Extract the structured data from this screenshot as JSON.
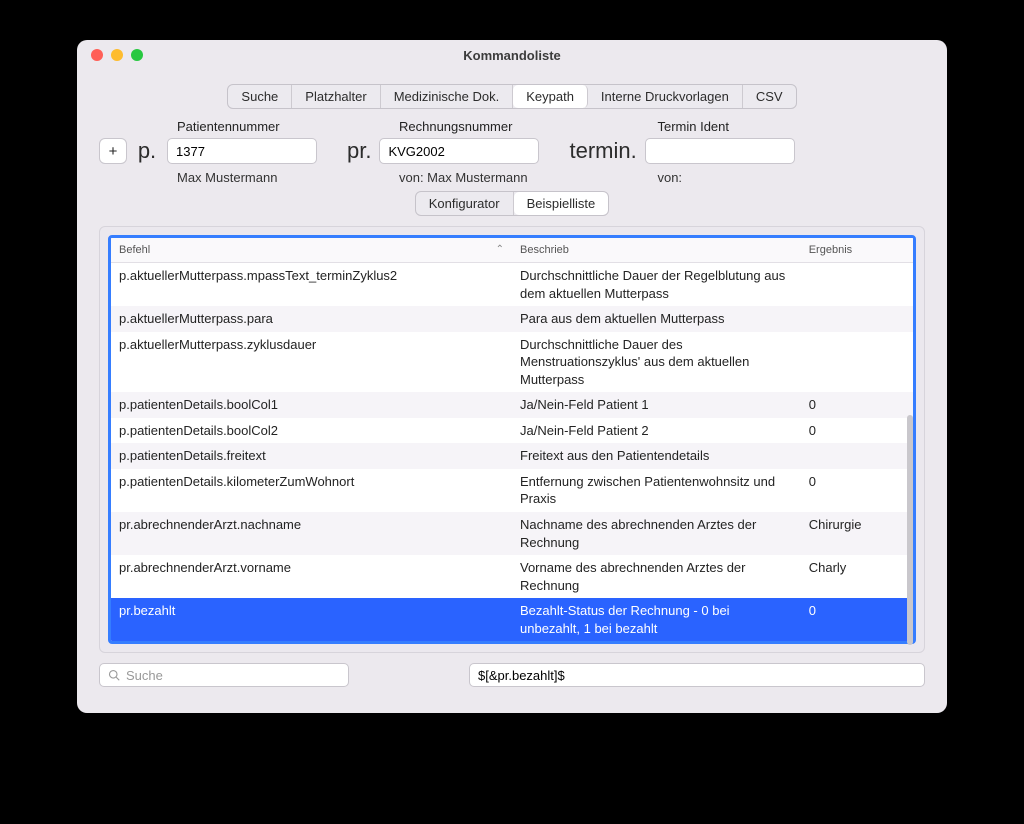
{
  "title": "Kommandoliste",
  "tabs": [
    "Suche",
    "Platzhalter",
    "Medizinische Dok.",
    "Keypath",
    "Interne Druckvorlagen",
    "CSV"
  ],
  "tabs_active": 3,
  "params": {
    "p": {
      "label": "Patientennummer",
      "prefix": "p.",
      "value": "1377",
      "sub": "Max Mustermann"
    },
    "pr": {
      "label": "Rechnungsnummer",
      "prefix": "pr.",
      "value": "KVG2002",
      "sub": "von:   Max Mustermann"
    },
    "termin": {
      "label": "Termin Ident",
      "prefix": "termin.",
      "value": "",
      "sub": "von:"
    }
  },
  "subtabs": [
    "Konfigurator",
    "Beispielliste"
  ],
  "subtabs_active": 1,
  "columns": {
    "befehl": "Befehl",
    "schrieb": "Beschrieb",
    "ergebnis": "Ergebnis"
  },
  "rows": [
    {
      "b": "p.aktuellerMutterpass.mpassText_terminZyklus2",
      "s": "Durchschnittliche Dauer der Regelblutung aus dem aktuellen Mutterpass",
      "e": ""
    },
    {
      "b": "p.aktuellerMutterpass.para",
      "s": "Para aus dem aktuellen Mutterpass",
      "e": ""
    },
    {
      "b": "p.aktuellerMutterpass.zyklusdauer",
      "s": "Durchschnittliche Dauer des Menstruationszyklus' aus dem aktuellen Mutterpass",
      "e": ""
    },
    {
      "b": "p.patientenDetails.boolCol1",
      "s": "Ja/Nein-Feld Patient 1",
      "e": "0"
    },
    {
      "b": "p.patientenDetails.boolCol2",
      "s": "Ja/Nein-Feld Patient 2",
      "e": "0"
    },
    {
      "b": "p.patientenDetails.freitext",
      "s": "Freitext aus den Patientendetails",
      "e": ""
    },
    {
      "b": "p.patientenDetails.kilometerZumWohnort",
      "s": "Entfernung zwischen Patientenwohnsitz und Praxis",
      "e": "0"
    },
    {
      "b": "pr.abrechnenderArzt.nachname",
      "s": "Nachname des abrechnenden Arztes der Rechnung",
      "e": "Chirurgie"
    },
    {
      "b": "pr.abrechnenderArzt.vorname",
      "s": "Vorname des abrechnenden Arztes der Rechnung",
      "e": "Charly"
    },
    {
      "b": "pr.bezahlt",
      "s": "Bezahlt-Status der Rechnung - 0 bei unbezahlt, 1 bei bezahlt",
      "e": "0",
      "selected": true
    }
  ],
  "search_placeholder": "Suche",
  "output": "$[&pr.bezahlt]$",
  "plus": "+"
}
